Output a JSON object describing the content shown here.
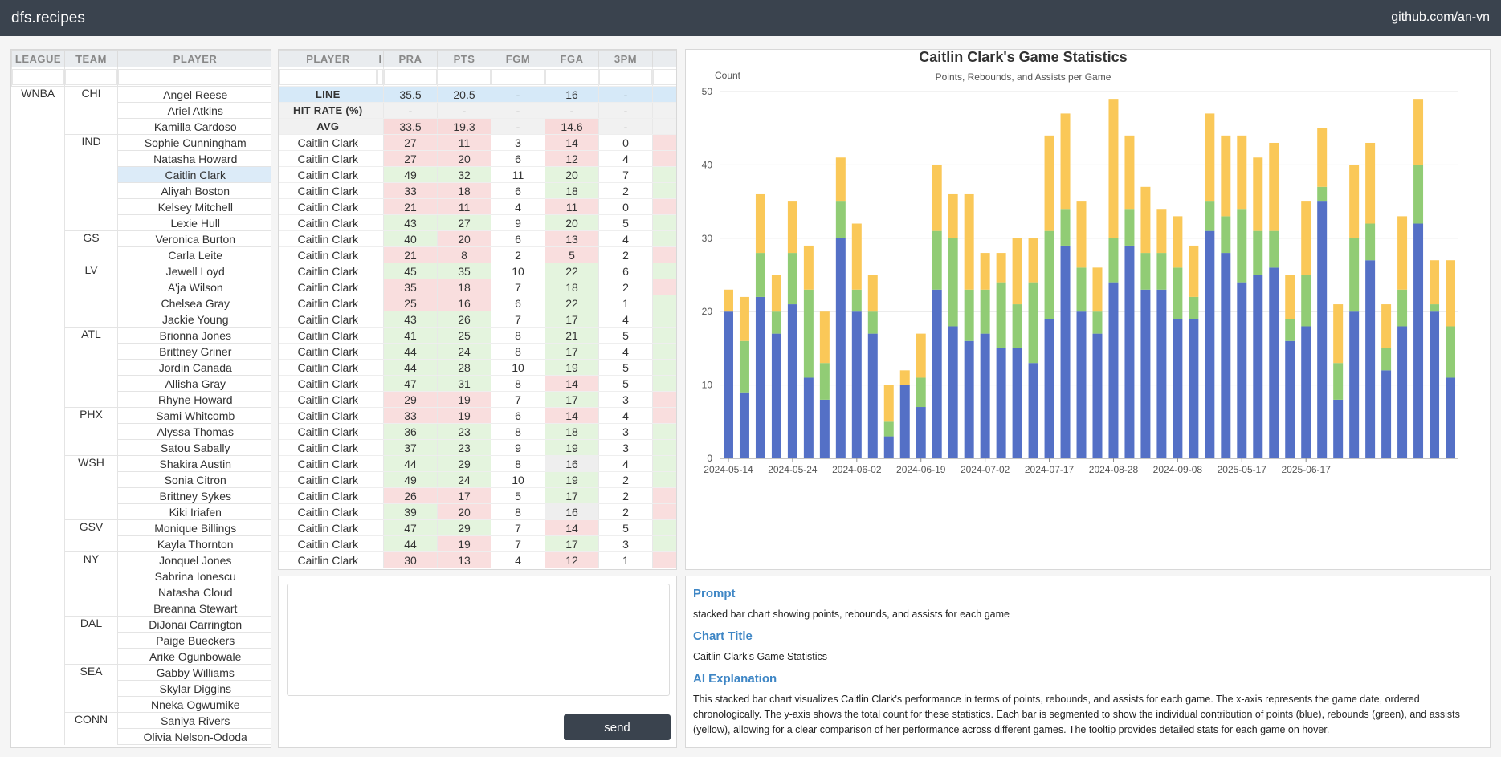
{
  "header": {
    "brand": "dfs.recipes",
    "github": "github.com/an-vn"
  },
  "left_table": {
    "headers": {
      "league": "LEAGUE",
      "team": "TEAM",
      "player": "PLAYER"
    },
    "league": "WNBA",
    "teams": [
      {
        "team": "CHI",
        "players": [
          "Angel Reese",
          "Ariel Atkins",
          "Kamilla Cardoso"
        ]
      },
      {
        "team": "IND",
        "players": [
          "Sophie Cunningham",
          "Natasha Howard",
          "Caitlin Clark",
          "Aliyah Boston",
          "Kelsey Mitchell",
          "Lexie Hull"
        ]
      },
      {
        "team": "GS",
        "players": [
          "Veronica Burton",
          "Carla Leite"
        ]
      },
      {
        "team": "LV",
        "players": [
          "Jewell Loyd",
          "A'ja Wilson",
          "Chelsea Gray",
          "Jackie Young"
        ]
      },
      {
        "team": "ATL",
        "players": [
          "Brionna Jones",
          "Brittney Griner",
          "Jordin Canada",
          "Allisha Gray",
          "Rhyne Howard"
        ]
      },
      {
        "team": "PHX",
        "players": [
          "Sami Whitcomb",
          "Alyssa Thomas",
          "Satou Sabally"
        ]
      },
      {
        "team": "WSH",
        "players": [
          "Shakira Austin",
          "Sonia Citron",
          "Brittney Sykes",
          "Kiki Iriafen"
        ]
      },
      {
        "team": "GSV",
        "players": [
          "Monique Billings",
          "Kayla Thornton"
        ]
      },
      {
        "team": "NY",
        "players": [
          "Jonquel Jones",
          "Sabrina Ionescu",
          "Natasha Cloud",
          "Breanna Stewart"
        ]
      },
      {
        "team": "DAL",
        "players": [
          "DiJonai Carrington",
          "Paige Bueckers",
          "Arike Ogunbowale"
        ]
      },
      {
        "team": "SEA",
        "players": [
          "Gabby Williams",
          "Skylar Diggins",
          "Nneka Ogwumike"
        ]
      },
      {
        "team": "CONN",
        "players": [
          "Saniya Rivers",
          "Olivia Nelson-Ododa"
        ]
      }
    ],
    "selected_player": "Caitlin Clark"
  },
  "stats_table": {
    "headers": [
      "PLAYER",
      "I",
      "PRA",
      "PTS",
      "FGM",
      "FGA",
      "3PM"
    ],
    "line": {
      "label": "LINE",
      "values": [
        "35.5",
        "20.5",
        "-",
        "16",
        "-"
      ]
    },
    "hit_rate": {
      "label": "HIT RATE (%)",
      "values": [
        "-",
        "-",
        "-",
        "-",
        "-"
      ]
    },
    "avg": {
      "label": "AVG",
      "values": [
        "33.5",
        "19.3",
        "-",
        "14.6",
        "-"
      ]
    },
    "player": "Caitlin Clark",
    "rows": [
      [
        27,
        11,
        3,
        14,
        0
      ],
      [
        27,
        20,
        6,
        12,
        4
      ],
      [
        49,
        32,
        11,
        20,
        7
      ],
      [
        33,
        18,
        6,
        18,
        2
      ],
      [
        21,
        11,
        4,
        11,
        0
      ],
      [
        43,
        27,
        9,
        20,
        5
      ],
      [
        40,
        20,
        6,
        13,
        4
      ],
      [
        21,
        8,
        2,
        5,
        2
      ],
      [
        45,
        35,
        10,
        22,
        6
      ],
      [
        35,
        18,
        7,
        18,
        2
      ],
      [
        25,
        16,
        6,
        22,
        1
      ],
      [
        43,
        26,
        7,
        17,
        4
      ],
      [
        41,
        25,
        8,
        21,
        5
      ],
      [
        44,
        24,
        8,
        17,
        4
      ],
      [
        44,
        28,
        10,
        19,
        5
      ],
      [
        47,
        31,
        8,
        14,
        5
      ],
      [
        29,
        19,
        7,
        17,
        3
      ],
      [
        33,
        19,
        6,
        14,
        4
      ],
      [
        36,
        23,
        8,
        18,
        3
      ],
      [
        37,
        23,
        9,
        19,
        3
      ],
      [
        44,
        29,
        8,
        16,
        4
      ],
      [
        49,
        24,
        10,
        19,
        2
      ],
      [
        26,
        17,
        5,
        17,
        2
      ],
      [
        39,
        20,
        8,
        16,
        2
      ],
      [
        47,
        29,
        7,
        14,
        5
      ],
      [
        44,
        19,
        7,
        17,
        3
      ],
      [
        30,
        13,
        4,
        12,
        1
      ]
    ],
    "trailing_col_colors": [
      "r",
      "r",
      "g",
      "g",
      "r",
      "g",
      "g",
      "r",
      "g",
      "r",
      "g",
      "g",
      "g",
      "g",
      "g",
      "g",
      "r",
      "r",
      "g",
      "g",
      "g",
      "g",
      "r",
      "r",
      "g",
      "g",
      "r"
    ]
  },
  "prompt": {
    "send_label": "send"
  },
  "info": {
    "prompt_heading": "Prompt",
    "prompt_text": "stacked bar chart showing points, rebounds, and assists for each game",
    "title_heading": "Chart Title",
    "title_text": "Caitlin Clark's Game Statistics",
    "explanation_heading": "AI Explanation",
    "explanation_text": "This stacked bar chart visualizes Caitlin Clark's performance in terms of points, rebounds, and assists for each game. The x-axis represents the game date, ordered chronologically. The y-axis shows the total count for these statistics. Each bar is segmented to show the individual contribution of points (blue), rebounds (green), and assists (yellow), allowing for a clear comparison of her performance across different games. The tooltip provides detailed stats for each game on hover."
  },
  "colors": {
    "points": "#5470c6",
    "rebounds": "#91cc75",
    "assists": "#fac858"
  },
  "chart_data": {
    "type": "bar",
    "stacked": true,
    "title": "Caitlin Clark's Game Statistics",
    "subtitle": "Points, Rebounds, and Assists per Game",
    "ylabel": "Count",
    "ylim": [
      0,
      50
    ],
    "yticks": [
      0,
      10,
      20,
      30,
      40,
      50
    ],
    "xtick_labels": [
      "2024-05-14",
      "2024-05-24",
      "2024-06-02",
      "2024-06-19",
      "2024-07-02",
      "2024-07-17",
      "2024-08-28",
      "2024-09-08",
      "2025-05-17",
      "2025-06-17"
    ],
    "xtick_every": 4,
    "grid": true,
    "series": [
      {
        "values": [
          20,
          9,
          22,
          17,
          21,
          11,
          8,
          30,
          20,
          17,
          3,
          10,
          7,
          23,
          18,
          16,
          17,
          15,
          15,
          13,
          19,
          29,
          20,
          17,
          24,
          29,
          23,
          23,
          19,
          19,
          31,
          28,
          24,
          25,
          26,
          16,
          18,
          35,
          8,
          20,
          27,
          12,
          18,
          32,
          20,
          11
        ]
      },
      {
        "values": [
          0,
          7,
          6,
          3,
          7,
          12,
          5,
          5,
          3,
          3,
          2,
          0,
          4,
          8,
          12,
          7,
          6,
          9,
          6,
          11,
          12,
          5,
          6,
          3,
          6,
          5,
          5,
          5,
          7,
          3,
          4,
          5,
          10,
          6,
          5,
          3,
          7,
          2,
          5,
          10,
          5,
          3,
          5,
          8,
          1,
          7
        ]
      },
      {
        "values": [
          3,
          6,
          8,
          5,
          7,
          6,
          7,
          6,
          9,
          5,
          5,
          2,
          6,
          9,
          6,
          13,
          5,
          4,
          9,
          6,
          13,
          13,
          9,
          6,
          19,
          10,
          9,
          6,
          7,
          7,
          12,
          11,
          10,
          10,
          12,
          6,
          10,
          8,
          8,
          10,
          11,
          6,
          10,
          9,
          6,
          9
        ]
      }
    ]
  }
}
